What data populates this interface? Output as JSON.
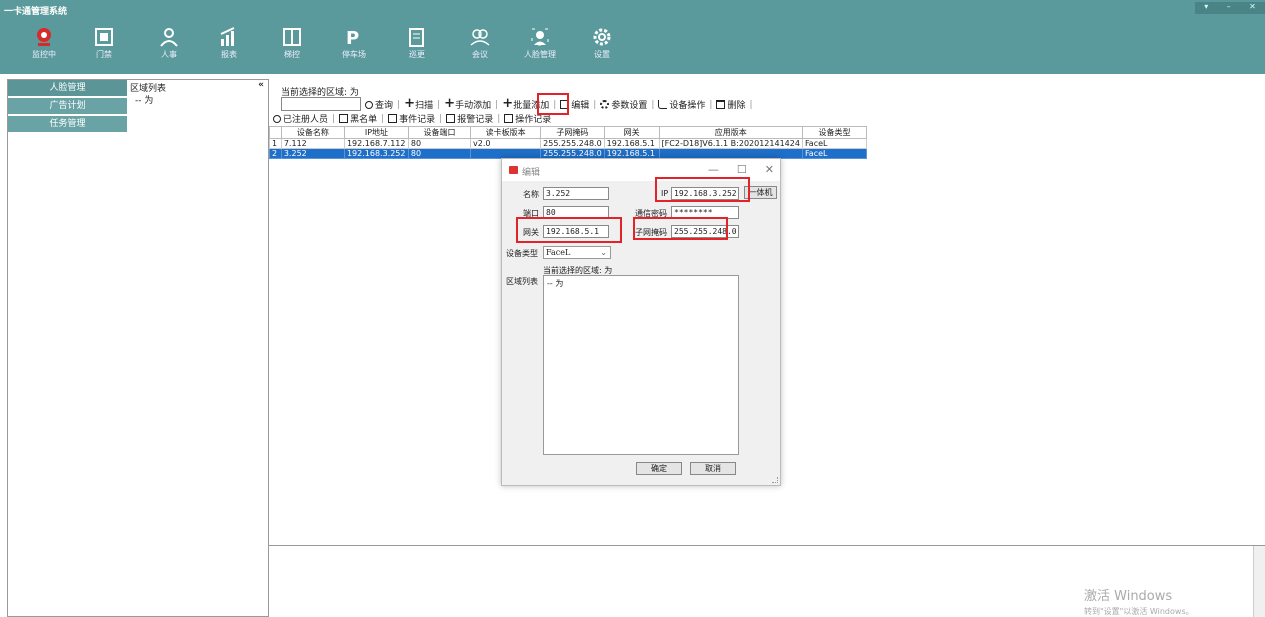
{
  "window": {
    "title": "一卡通管理系统",
    "controls": [
      "▾",
      "–",
      "✕"
    ]
  },
  "toolbar": [
    {
      "id": "monitor",
      "label": "监控中"
    },
    {
      "id": "access",
      "label": "门禁"
    },
    {
      "id": "hr",
      "label": "人事"
    },
    {
      "id": "report",
      "label": "报表"
    },
    {
      "id": "elevator",
      "label": "梯控"
    },
    {
      "id": "parking",
      "label": "停车场"
    },
    {
      "id": "patrol",
      "label": "巡更"
    },
    {
      "id": "meeting",
      "label": "会议"
    },
    {
      "id": "face",
      "label": "人脸管理"
    },
    {
      "id": "settings",
      "label": "设置"
    }
  ],
  "leftnav": [
    "人脸管理",
    "广告计划",
    "任务管理"
  ],
  "region_panel": {
    "title": "区域列表",
    "collapse": "«",
    "node": "-- 为"
  },
  "main": {
    "current_region": "当前选择的区域: 为",
    "actions_row1": [
      "查询",
      "扫描",
      "手动添加",
      "批量添加",
      "编辑",
      "参数设置",
      "设备操作",
      "删除"
    ],
    "actions_row2": [
      "已注册人员",
      "黑名单",
      "事件记录",
      "报警记录",
      "操作记录"
    ]
  },
  "table": {
    "headers": [
      "设备名称",
      "IP地址",
      "设备端口",
      "读卡板版本",
      "子网掩码",
      "网关",
      "应用版本",
      "设备类型"
    ],
    "rows": [
      {
        "num": "1",
        "name": "7.112",
        "ip": "192.168.7.112",
        "port": "80",
        "board": "v2.0",
        "mask": "255.255.248.0",
        "gateway": "192.168.5.1",
        "app": "[FC2-D18]V6.1.1 B:202012141424",
        "type": "FaceL"
      },
      {
        "num": "2",
        "name": "3.252",
        "ip": "192.168.3.252",
        "port": "80",
        "board": "",
        "mask": "255.255.248.0",
        "gateway": "192.168.5.1",
        "app": "",
        "type": "FaceL"
      }
    ]
  },
  "modal": {
    "title": "编辑",
    "name_label": "名称",
    "name_value": "3.252",
    "ip_label": "IP",
    "ip_value": "192.168.3.252",
    "allinone_btn": "一体机",
    "port_label": "端口",
    "port_value": "80",
    "pwd_label": "通信密码",
    "pwd_value": "********",
    "gateway_label": "网关",
    "gateway_value": "192.168.5.1",
    "mask_label": "子网掩码",
    "mask_value": "255.255.248.0",
    "type_label": "设备类型",
    "type_value": "FaceL",
    "region_label": "区域列表",
    "current_region": "当前选择的区域: 为",
    "region_node": "-- 为",
    "ok": "确定",
    "cancel": "取消",
    "ctrls": [
      "—",
      "☐",
      "✕"
    ]
  },
  "watermark": {
    "title": "激活 Windows",
    "sub": "转到\"设置\"以激活 Windows。"
  },
  "colors": {
    "header": "#5b9a9c",
    "selected_row": "#1d6fc9",
    "highlight": "#e3232a"
  }
}
